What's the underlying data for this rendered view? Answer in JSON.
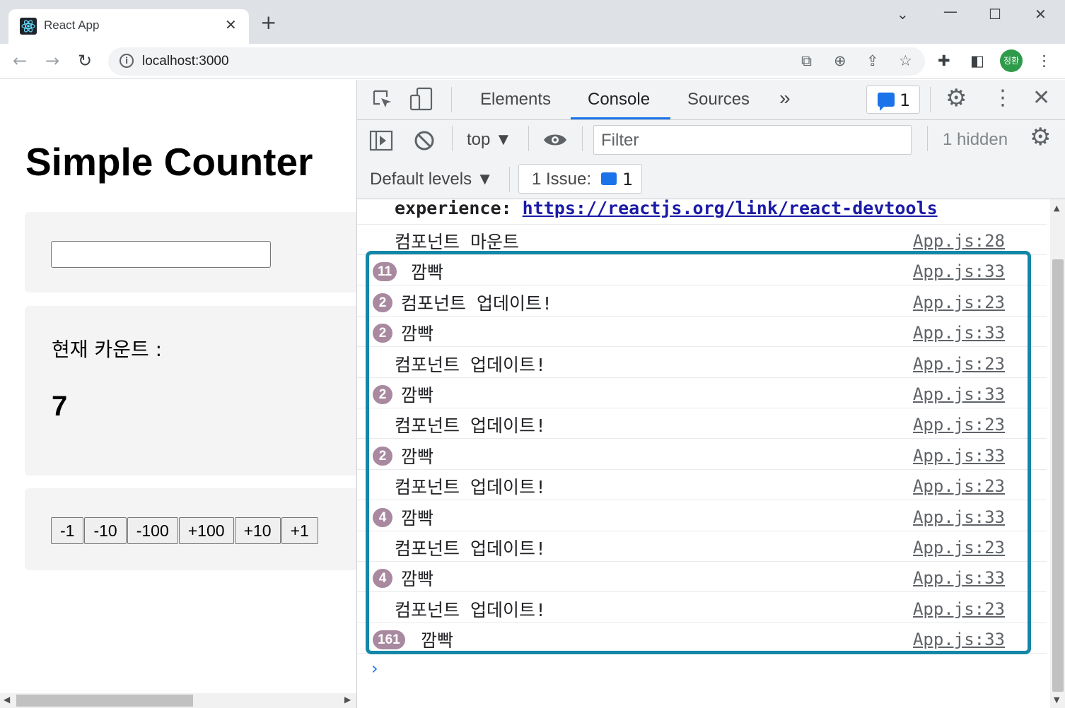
{
  "browser": {
    "tab_title": "React App",
    "url": "localhost:3000",
    "profile_initials": "정환"
  },
  "page": {
    "heading": "Simple Counter",
    "input_value": "",
    "count_label": "현재 카운트 :",
    "count_value": "7",
    "buttons": [
      "-1",
      "-10",
      "-100",
      "+100",
      "+10",
      "+1"
    ]
  },
  "devtools": {
    "tabs": [
      "Elements",
      "Console",
      "Sources"
    ],
    "active_tab": "Console",
    "issues_count": "1",
    "context": "top",
    "filter_placeholder": "Filter",
    "hidden": "1 hidden",
    "levels": "Default levels",
    "issue_label": "1 Issue:",
    "issue_count2": "1",
    "first_line_label": "experience:",
    "first_line_link": "https://reactjs.org/link/react-devtools",
    "logs": [
      {
        "badge": "",
        "text": "컴포넌트 마운트",
        "src": "App.js:28"
      },
      {
        "badge": "11",
        "text": "깜빡",
        "src": "App.js:33"
      },
      {
        "badge": "2",
        "text": "컴포넌트 업데이트!",
        "src": "App.js:23"
      },
      {
        "badge": "2",
        "text": "깜빡",
        "src": "App.js:33"
      },
      {
        "badge": "",
        "text": "컴포넌트 업데이트!",
        "src": "App.js:23"
      },
      {
        "badge": "2",
        "text": "깜빡",
        "src": "App.js:33"
      },
      {
        "badge": "",
        "text": "컴포넌트 업데이트!",
        "src": "App.js:23"
      },
      {
        "badge": "2",
        "text": "깜빡",
        "src": "App.js:33"
      },
      {
        "badge": "",
        "text": "컴포넌트 업데이트!",
        "src": "App.js:23"
      },
      {
        "badge": "4",
        "text": "깜빡",
        "src": "App.js:33"
      },
      {
        "badge": "",
        "text": "컴포넌트 업데이트!",
        "src": "App.js:23"
      },
      {
        "badge": "4",
        "text": "깜빡",
        "src": "App.js:33"
      },
      {
        "badge": "",
        "text": "컴포넌트 업데이트!",
        "src": "App.js:23"
      },
      {
        "badge": "161",
        "text": "깜빡",
        "src": "App.js:33"
      }
    ]
  },
  "colors": {
    "accent": "#1a73e8",
    "highlight_border": "#1387a8",
    "badge": "#a8899f"
  }
}
